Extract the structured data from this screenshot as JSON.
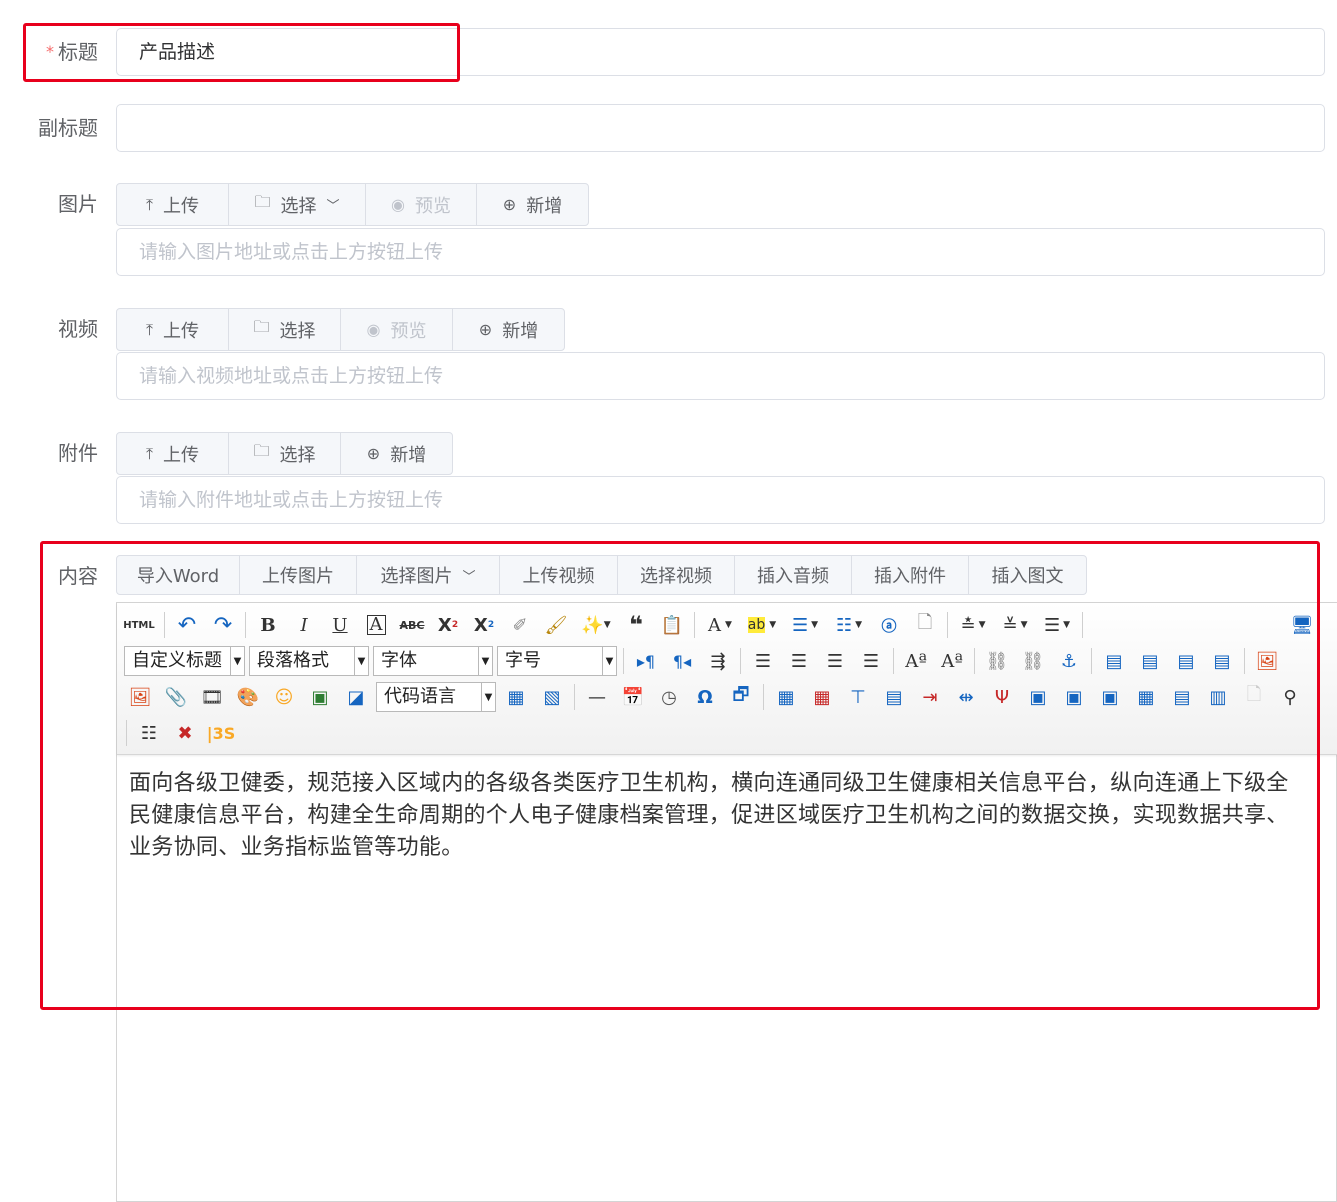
{
  "title_field": {
    "label": "标题",
    "required_mark": "*",
    "value": "产品描述"
  },
  "subtitle_field": {
    "label": "副标题",
    "value": ""
  },
  "image_field": {
    "label": "图片",
    "buttons": {
      "upload": "上传",
      "select": "选择",
      "preview": "预览",
      "add": "新增"
    },
    "placeholder": "请输入图片地址或点击上方按钮上传"
  },
  "video_field": {
    "label": "视频",
    "buttons": {
      "upload": "上传",
      "select": "选择",
      "preview": "预览",
      "add": "新增"
    },
    "placeholder": "请输入视频地址或点击上方按钮上传"
  },
  "attachment_field": {
    "label": "附件",
    "buttons": {
      "upload": "上传",
      "select": "选择",
      "add": "新增"
    },
    "placeholder": "请输入附件地址或点击上方按钮上传"
  },
  "content_field": {
    "label": "内容",
    "actions": {
      "import_word": "导入Word",
      "upload_image": "上传图片",
      "select_image": "选择图片",
      "upload_video": "上传视频",
      "select_video": "选择视频",
      "insert_audio": "插入音频",
      "insert_attachment": "插入附件",
      "insert_article": "插入图文"
    },
    "toolbar": {
      "html_label": "HTML",
      "custom_heading": "自定义标题",
      "paragraph_format": "段落格式",
      "font_family": "字体",
      "font_size": "字号",
      "code_language": "代码语言"
    },
    "body_text": "面向各级卫健委，规范接入区域内的各级各类医疗卫生机构，横向连通同级卫生健康相关信息平台，纵向连通上下级全民健康信息平台，构建全生命周期的个人电子健康档案管理，促进区域医疗卫生机构之间的数据交换，实现数据共享、业务协同、业务指标监管等功能。"
  },
  "colors": {
    "highlight": "#e8001c",
    "required": "#f56c6c",
    "border": "#dcdfe6",
    "placeholder": "#c0c4cc",
    "link_blue": "#1565c0"
  }
}
